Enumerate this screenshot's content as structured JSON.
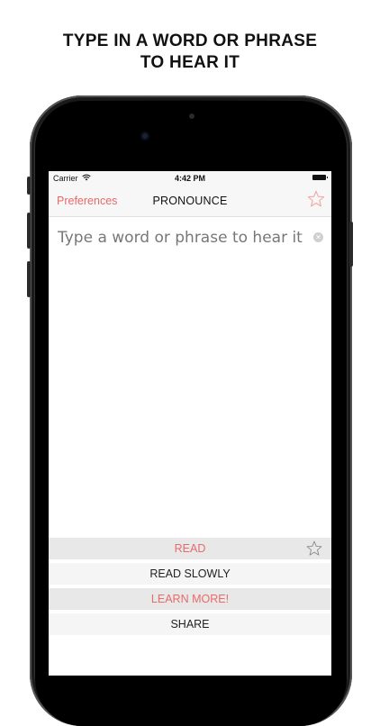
{
  "caption": {
    "line1": "TYPE IN A WORD OR PHRASE",
    "line2": "TO HEAR IT"
  },
  "status_bar": {
    "carrier": "Carrier",
    "time": "4:42 PM"
  },
  "nav": {
    "left_label": "Preferences",
    "title": "PRONOUNCE",
    "accent_color": "#e86a6a"
  },
  "input": {
    "placeholder": "Type a word or phrase to hear it",
    "value": ""
  },
  "actions": {
    "read": "READ",
    "read_slowly": "READ SLOWLY",
    "learn_more": "LEARN MORE!",
    "share": "SHARE"
  }
}
